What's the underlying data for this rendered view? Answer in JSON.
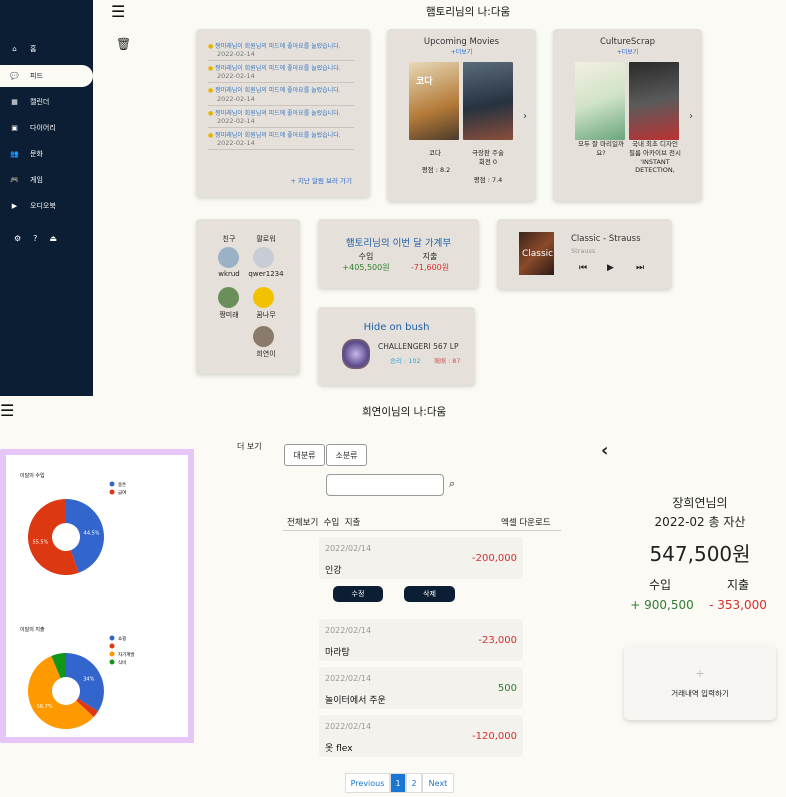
{
  "sidebar": {
    "items": [
      {
        "icon": "home-icon",
        "label": "홈"
      },
      {
        "icon": "chat-icon",
        "label": "피드"
      },
      {
        "icon": "calendar-icon",
        "label": "캘린더"
      },
      {
        "icon": "diary-icon",
        "label": "다이어리"
      },
      {
        "icon": "culture-icon",
        "label": "문화"
      },
      {
        "icon": "game-icon",
        "label": "게임"
      },
      {
        "icon": "audio-icon",
        "label": "오디오북"
      }
    ]
  },
  "top": {
    "title": "햄토리님의 나:다움",
    "notifications": [
      {
        "text": "짱미래님이 회원님의 피드에 좋아요를 눌렀습니다.",
        "date": "2022-02-14"
      },
      {
        "text": "짱미래님이 회원님의 피드에 좋아요를 눌렀습니다.",
        "date": "2022-02-14"
      },
      {
        "text": "짱미래님이 회원님의 피드에 좋아요를 눌렀습니다.",
        "date": "2022-02-14"
      },
      {
        "text": "짱미래님이 회원님의 피드에 좋아요를 눌렀습니다.",
        "date": "2022-02-14"
      },
      {
        "text": "짱미래님이 회원님의 피드에 좋아요를 눌렀습니다.",
        "date": "2022-02-14"
      }
    ],
    "past_link": "+ 지난 알림 보러 가기",
    "movies": {
      "title": "Upcoming Movies",
      "more": "+더보기",
      "items": [
        {
          "name": "코다",
          "score": "평점 : 8.2"
        },
        {
          "name": "극장판 주술\n회전 0",
          "score": "평점 : 7.4"
        }
      ]
    },
    "culture": {
      "title": "CultureScrap",
      "more": "+더보기",
      "items": [
        {
          "name": "모두 잘 마리일까\n요?"
        },
        {
          "name": "국내 최초 디자인\n필름 아카이브 전시\n'INSTANT\nDETECTION,"
        }
      ]
    },
    "friends": {
      "friend_label": "친구",
      "follower_label": "팔로워",
      "left": [
        "wkrud",
        "짱미래"
      ],
      "right": [
        "qwer1234",
        "꿈나무",
        "희연이"
      ]
    },
    "budget": {
      "title": "햄토리님의 이번 달 가계부",
      "income_label": "수입",
      "expense_label": "지출",
      "income": "+405,500원",
      "expense": "-71,600원"
    },
    "music": {
      "title": "Classic - Strauss",
      "artist": "Strauss",
      "cover": "Classic"
    },
    "game": {
      "title": "Hide on bush",
      "rank": "CHALLENGERⅠ 567 LP",
      "win": "승리 : 102",
      "loss": "패배 : 87"
    }
  },
  "bottom": {
    "title": "희연이님의 나:다움",
    "more_label": "더 보기",
    "cat1": "대분류",
    "cat2": "소분류",
    "search_placeholder": "",
    "filters": "전체보기  수입  지출",
    "excel": "엑셀 다운로드",
    "edit": "수정",
    "delete": "삭제",
    "tx": [
      {
        "date": "2022/02/14",
        "name": "인강",
        "amount": "-200,000",
        "color": "#d32f2f"
      },
      {
        "date": "2022/02/14",
        "name": "마라탕",
        "amount": "-23,000",
        "color": "#d32f2f"
      },
      {
        "date": "2022/02/14",
        "name": "놀이터에서 주운",
        "amount": "500",
        "color": "#2e7d32"
      },
      {
        "date": "2022/02/14",
        "name": "옷 flex",
        "amount": "-120,000",
        "color": "#d32f2f"
      }
    ],
    "pager": {
      "prev": "Previous",
      "p1": "1",
      "p2": "2",
      "next": "Next"
    },
    "asset": {
      "name": "장희연님의",
      "month": "2022-02 총 자산",
      "total": "547,500원",
      "income_label": "수입",
      "expense_label": "지출",
      "income": "+ 900,500",
      "expense": "- 353,000",
      "add_plus": "+",
      "add_label": "거래내역 입력하기"
    },
    "pie1": {
      "title": "이달의 수입",
      "legend": [
        "용돈",
        "급여"
      ],
      "colors": [
        "#3366cc",
        "#dc3912"
      ],
      "values": [
        44.5,
        55.5
      ],
      "labels": [
        "44.5%",
        "55.5%"
      ]
    },
    "pie2": {
      "title": "이달의 지출",
      "legend": [
        "쇼핑",
        "",
        "자기계발",
        "식비"
      ],
      "colors": [
        "#3366cc",
        "#dc3912",
        "#ff9900",
        "#109618"
      ],
      "values": [
        34,
        3,
        56.7,
        6.3
      ],
      "labels": [
        "34%",
        "",
        "56.7%",
        ""
      ]
    }
  }
}
